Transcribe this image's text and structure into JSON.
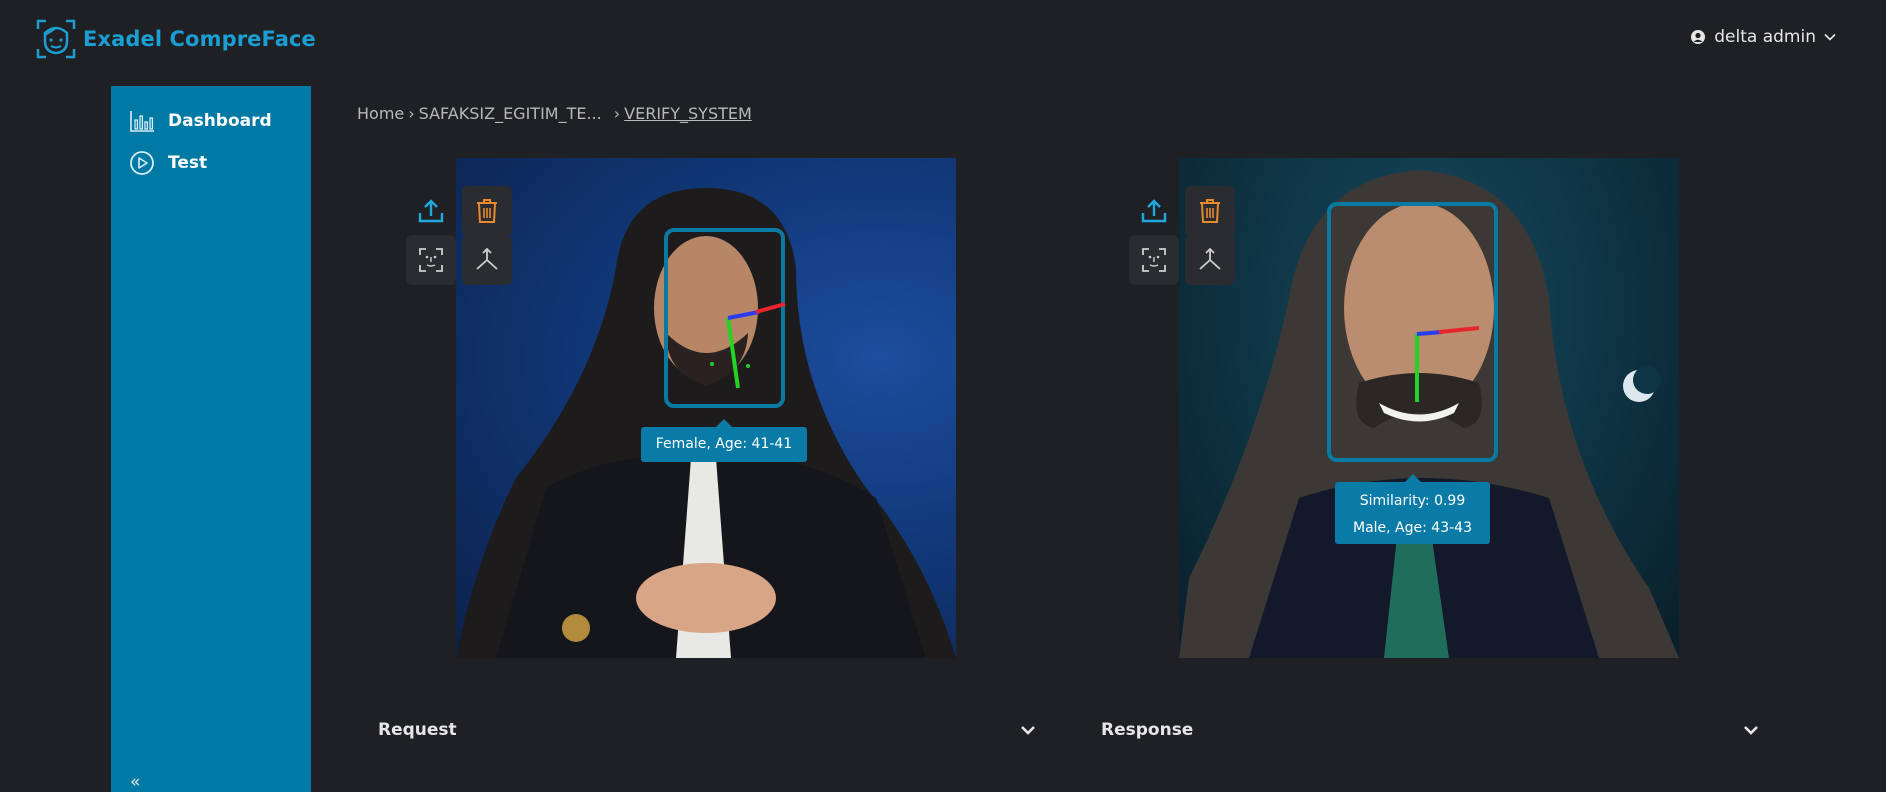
{
  "app": {
    "title": "Exadel CompreFace"
  },
  "user": {
    "name": "delta admin"
  },
  "sidebar": {
    "items": [
      {
        "label": "Dashboard",
        "icon": "bar-chart-icon"
      },
      {
        "label": "Test",
        "icon": "play-circle-icon"
      }
    ],
    "collapse_label": "«"
  },
  "breadcrumb": {
    "home": "Home",
    "sep1": "›",
    "app": "SAFAKSIZ_EGITIM_TE...",
    "sep2": "›",
    "current": "VERIFY_SYSTEM"
  },
  "left_face": {
    "label": "Female, Age: 41-41",
    "tools": [
      "upload-icon",
      "delete-icon",
      "face-scan-icon",
      "landmarks-icon"
    ]
  },
  "right_face": {
    "similarity": "Similarity: 0.99",
    "label": "Male, Age: 43-43",
    "tools": [
      "upload-icon",
      "delete-icon",
      "face-scan-icon",
      "landmarks-icon"
    ]
  },
  "panels": {
    "request": "Request",
    "response": "Response"
  },
  "colors": {
    "accent": "#1a9ed3",
    "sidebar": "#0079a4",
    "delete": "#e88a2d",
    "upload": "#1fa8e0"
  }
}
